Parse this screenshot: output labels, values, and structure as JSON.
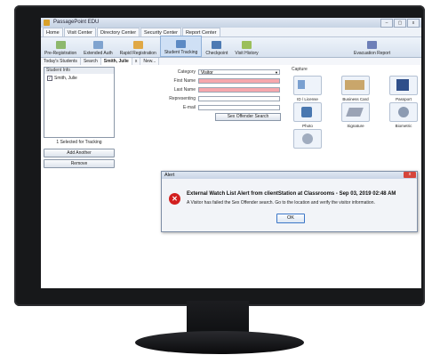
{
  "app": {
    "title": "PassagePoint EDU",
    "window_buttons": [
      "–",
      "▢",
      "x"
    ]
  },
  "menu_tabs": [
    "Home",
    "Visit Center",
    "Directory Center",
    "Security Center",
    "Report Center"
  ],
  "ribbon": {
    "buttons": [
      {
        "label": "Pre-Registration",
        "icon": "pre-registration-icon",
        "color": "#8db86c"
      },
      {
        "label": "Extended Auth",
        "icon": "extended-auth-icon",
        "color": "#7fa3cf"
      },
      {
        "label": "Rapid Registration",
        "icon": "rapid-registration-icon",
        "color": "#e0a845"
      },
      {
        "label": "Student Tracking",
        "icon": "student-tracking-icon",
        "color": "#5c8ac4"
      },
      {
        "label": "Checkpoint",
        "icon": "checkpoint-icon",
        "color": "#4d7ab3"
      },
      {
        "label": "Visit History",
        "icon": "visit-history-icon",
        "color": "#9bbf5a"
      }
    ],
    "report": {
      "label": "Evacuation Report",
      "icon": "evacuation-report-icon",
      "color": "#6d7fb8"
    }
  },
  "sub_tabs": [
    "Today's Students",
    "Search",
    "Smith, Julie",
    "x",
    "New..."
  ],
  "student_info": {
    "title": "Student Info",
    "students": [
      {
        "name": "Smith, Julie",
        "checked": "✓"
      }
    ],
    "tracking_text": "1 Selected for Tracking",
    "add_another": "Add Another",
    "remove": "Remove"
  },
  "form": {
    "category_label": "Category",
    "category_value": "Visitor",
    "first_name_label": "First Name",
    "last_name_label": "Last Name",
    "representing_label": "Representing",
    "email_label": "E-mail",
    "sex_offender_button": "Sex Offender Search"
  },
  "capture": {
    "title": "Capture",
    "items": [
      {
        "label": "ID / License",
        "icon": "id-license-icon"
      },
      {
        "label": "Business Card",
        "icon": "business-card-icon"
      },
      {
        "label": "Passport",
        "icon": "passport-icon"
      },
      {
        "label": "Photo",
        "icon": "photo-icon"
      },
      {
        "label": "Signature",
        "icon": "signature-icon"
      },
      {
        "label": "Biometric",
        "icon": "biometric-icon"
      },
      {
        "label": "",
        "icon": "fingerprint-icon"
      }
    ]
  },
  "alert": {
    "title": "Alert",
    "heading": "External Watch List Alert from clientStation at Classrooms - Sep 03, 2019 02:48 AM",
    "message": "A Visitor has failed the Sex Offender search. Go to the location and verify the visitor information.",
    "ok": "OK",
    "close": "x",
    "error_symbol": "✕"
  }
}
